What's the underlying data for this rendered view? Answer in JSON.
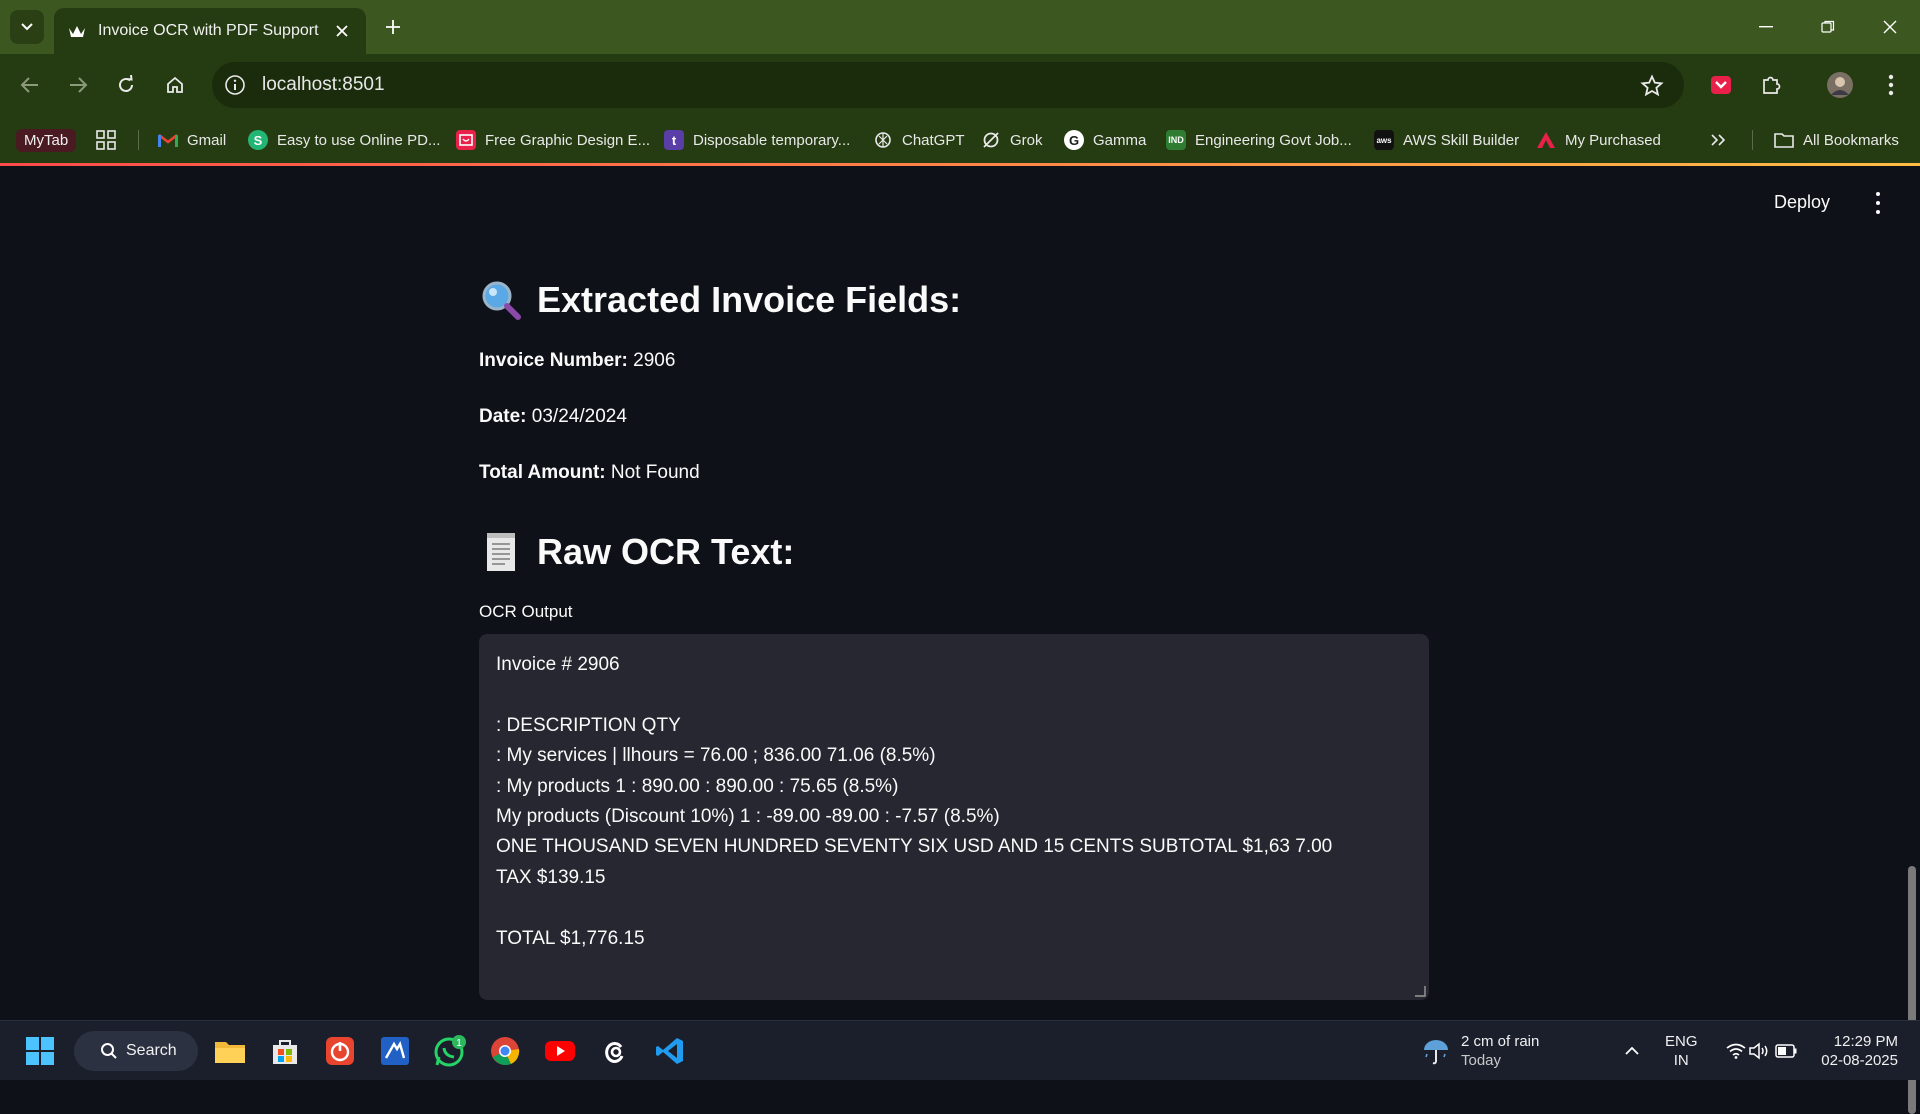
{
  "browser": {
    "tab_title": "Invoice OCR with PDF Support",
    "url": "localhost:8501",
    "bookmarks": {
      "mytab": "MyTab",
      "gmail": "Gmail",
      "pdf": "Easy to use Online PD...",
      "graphic": "Free Graphic Design E...",
      "disposable": "Disposable temporary...",
      "chatgpt": "ChatGPT",
      "grok": "Grok",
      "gamma": "Gamma",
      "engineering": "Engineering Govt Job...",
      "aws": "AWS Skill Builder",
      "purchased": "My Purchased",
      "all": "All Bookmarks"
    }
  },
  "app": {
    "deploy_label": "Deploy",
    "extracted_heading": "Extracted Invoice Fields:",
    "fields": {
      "invoice_label": "Invoice Number:",
      "invoice_value": "2906",
      "date_label": "Date:",
      "date_value": "03/24/2024",
      "total_label": "Total Amount:",
      "total_value": "Not Found"
    },
    "raw_heading": "Raw OCR Text:",
    "ocr_label": "OCR Output",
    "ocr_lines": [
      "Invoice # 2906",
      "",
      ": DESCRIPTION QTY",
      ": My services | llhours = 76.00 ; 836.00 71.06 (8.5%)",
      ": My products 1 : 890.00 : 890.00 : 75.65 (8.5%)",
      "My products (Discount 10%) 1 : -89.00 -89.00 : -7.57 (8.5%)",
      "ONE THOUSAND SEVEN HUNDRED SEVENTY SIX USD AND 15 CENTS SUBTOTAL $1,63 7.00",
      "TAX $139.15",
      "",
      "TOTAL $1,776.15"
    ]
  },
  "taskbar": {
    "search_label": "Search",
    "whatsapp_badge": "1",
    "weather_line1": "2 cm of rain",
    "weather_line2": "Today",
    "lang_line1": "ENG",
    "lang_line2": "IN",
    "time": "12:29 PM",
    "date": "02-08-2025"
  },
  "colors": {
    "tab_bar": "#3c571f",
    "toolbar": "#253b12",
    "app_bg": "#0e1117",
    "textarea_bg": "#262730",
    "accent_gradient_start": "#ff4b4b",
    "accent_gradient_end": "#ffbd45"
  }
}
